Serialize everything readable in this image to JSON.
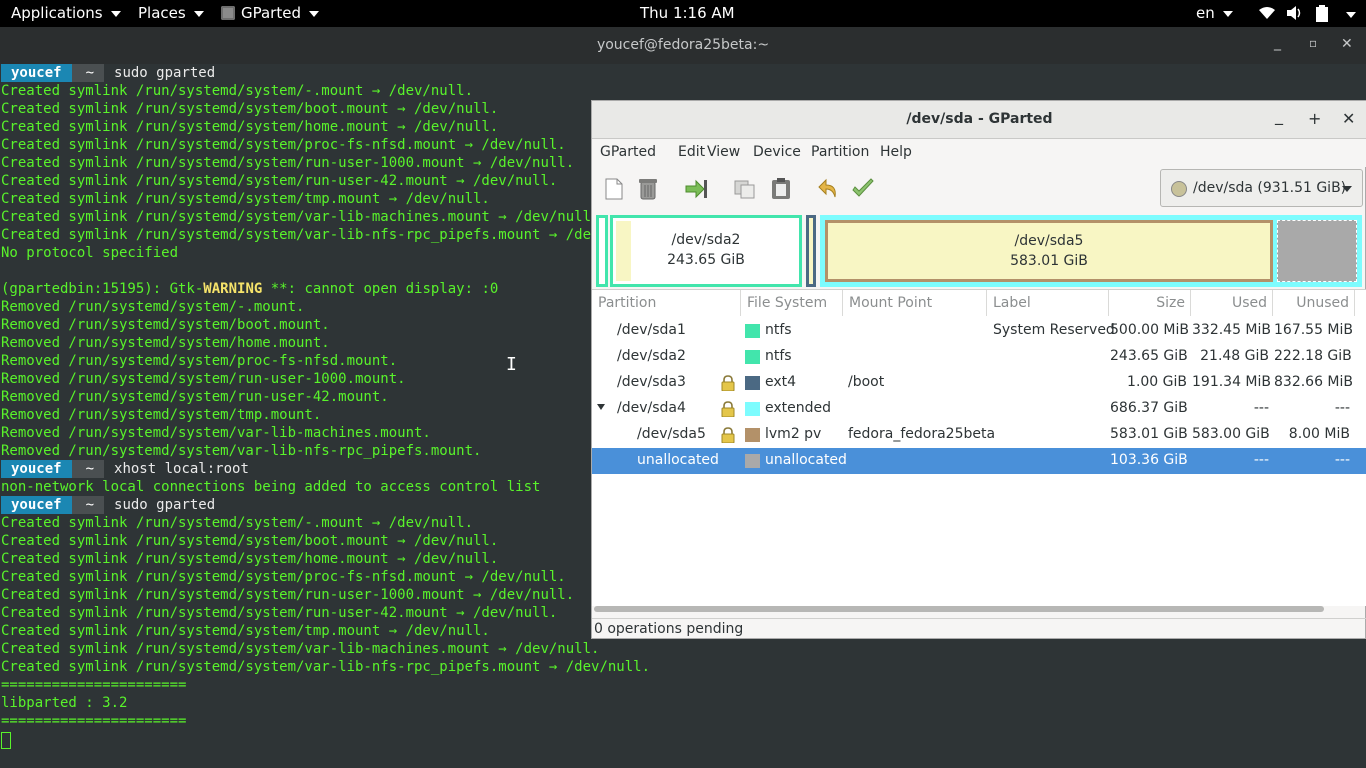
{
  "topbar": {
    "applications": "Applications",
    "places": "Places",
    "app_menu": "GParted",
    "clock": "Thu  1:16 AM",
    "lang": "en"
  },
  "terminal": {
    "title": "youcef@fedora25beta:~",
    "prompt_user": "youcef",
    "prompt_dir": "~",
    "lines": [
      {
        "t": "prompt",
        "cmd": "sudo gparted"
      },
      {
        "t": "text",
        "s": "Created symlink /run/systemd/system/-.mount → /dev/null."
      },
      {
        "t": "text",
        "s": "Created symlink /run/systemd/system/boot.mount → /dev/null."
      },
      {
        "t": "text",
        "s": "Created symlink /run/systemd/system/home.mount → /dev/null."
      },
      {
        "t": "text",
        "s": "Created symlink /run/systemd/system/proc-fs-nfsd.mount → /dev/null."
      },
      {
        "t": "text",
        "s": "Created symlink /run/systemd/system/run-user-1000.mount → /dev/null."
      },
      {
        "t": "text",
        "s": "Created symlink /run/systemd/system/run-user-42.mount → /dev/null."
      },
      {
        "t": "text",
        "s": "Created symlink /run/systemd/system/tmp.mount → /dev/null."
      },
      {
        "t": "text",
        "s": "Created symlink /run/systemd/system/var-lib-machines.mount → /dev/null."
      },
      {
        "t": "text",
        "s": "Created symlink /run/systemd/system/var-lib-nfs-rpc_pipefs.mount → /dev/null."
      },
      {
        "t": "text",
        "s": "No protocol specified"
      },
      {
        "t": "text",
        "s": ""
      },
      {
        "t": "warn",
        "a": "(gpartedbin:15195): Gtk-",
        "b": "WARNING",
        "c": " **: cannot open display: :0"
      },
      {
        "t": "text",
        "s": "Removed /run/systemd/system/-.mount."
      },
      {
        "t": "text",
        "s": "Removed /run/systemd/system/boot.mount."
      },
      {
        "t": "text",
        "s": "Removed /run/systemd/system/home.mount."
      },
      {
        "t": "text",
        "s": "Removed /run/systemd/system/proc-fs-nfsd.mount."
      },
      {
        "t": "text",
        "s": "Removed /run/systemd/system/run-user-1000.mount."
      },
      {
        "t": "text",
        "s": "Removed /run/systemd/system/run-user-42.mount."
      },
      {
        "t": "text",
        "s": "Removed /run/systemd/system/tmp.mount."
      },
      {
        "t": "text",
        "s": "Removed /run/systemd/system/var-lib-machines.mount."
      },
      {
        "t": "text",
        "s": "Removed /run/systemd/system/var-lib-nfs-rpc_pipefs.mount."
      },
      {
        "t": "prompt",
        "cmd": "xhost local:root"
      },
      {
        "t": "text",
        "s": "non-network local connections being added to access control list"
      },
      {
        "t": "prompt",
        "cmd": "sudo gparted"
      },
      {
        "t": "text",
        "s": "Created symlink /run/systemd/system/-.mount → /dev/null."
      },
      {
        "t": "text",
        "s": "Created symlink /run/systemd/system/boot.mount → /dev/null."
      },
      {
        "t": "text",
        "s": "Created symlink /run/systemd/system/home.mount → /dev/null."
      },
      {
        "t": "text",
        "s": "Created symlink /run/systemd/system/proc-fs-nfsd.mount → /dev/null."
      },
      {
        "t": "text",
        "s": "Created symlink /run/systemd/system/run-user-1000.mount → /dev/null."
      },
      {
        "t": "text",
        "s": "Created symlink /run/systemd/system/run-user-42.mount → /dev/null."
      },
      {
        "t": "text",
        "s": "Created symlink /run/systemd/system/tmp.mount → /dev/null."
      },
      {
        "t": "text",
        "s": "Created symlink /run/systemd/system/var-lib-machines.mount → /dev/null."
      },
      {
        "t": "text",
        "s": "Created symlink /run/systemd/system/var-lib-nfs-rpc_pipefs.mount → /dev/null."
      },
      {
        "t": "text",
        "s": "======================"
      },
      {
        "t": "text",
        "s": "libparted : 3.2"
      },
      {
        "t": "text",
        "s": "======================"
      }
    ]
  },
  "gparted": {
    "title": "/dev/sda - GParted",
    "menu": [
      "GParted",
      "Edit",
      "View",
      "Device",
      "Partition",
      "Help"
    ],
    "device_selector": "/dev/sda  (931.51 GiB)",
    "map": {
      "sda2_name": "/dev/sda2",
      "sda2_size": "243.65 GiB",
      "sda5_name": "/dev/sda5",
      "sda5_size": "583.01 GiB"
    },
    "columns": [
      "Partition",
      "File System",
      "Mount Point",
      "Label",
      "Size",
      "Used",
      "Unused"
    ],
    "rows": [
      {
        "partition": "/dev/sda1",
        "fs": "ntfs",
        "fs_color": "#42e5ac",
        "mount": "",
        "label": "System Reserved",
        "size": "500.00 MiB",
        "used": "332.45 MiB",
        "unused": "167.55 MiB",
        "lock": false,
        "indent": false,
        "expander": false
      },
      {
        "partition": "/dev/sda2",
        "fs": "ntfs",
        "fs_color": "#42e5ac",
        "mount": "",
        "label": "",
        "size": "243.65 GiB",
        "used": "21.48 GiB",
        "unused": "222.18 GiB",
        "lock": false,
        "indent": false,
        "expander": false
      },
      {
        "partition": "/dev/sda3",
        "fs": "ext4",
        "fs_color": "#4b6983",
        "mount": "/boot",
        "label": "",
        "size": "1.00 GiB",
        "used": "191.34 MiB",
        "unused": "832.66 MiB",
        "lock": true,
        "indent": false,
        "expander": false
      },
      {
        "partition": "/dev/sda4",
        "fs": "extended",
        "fs_color": "#7dfcfe",
        "mount": "",
        "label": "",
        "size": "686.37 GiB",
        "used": "---",
        "unused": "---",
        "lock": true,
        "indent": false,
        "expander": true
      },
      {
        "partition": "/dev/sda5",
        "fs": "lvm2 pv",
        "fs_color": "#b39169",
        "mount": "fedora_fedora25beta",
        "label": "",
        "size": "583.01 GiB",
        "used": "583.00 GiB",
        "unused": "8.00 MiB",
        "lock": true,
        "indent": true,
        "expander": false
      },
      {
        "partition": "unallocated",
        "fs": "unallocated",
        "fs_color": "#a9a9a9",
        "mount": "",
        "label": "",
        "size": "103.36 GiB",
        "used": "---",
        "unused": "---",
        "lock": false,
        "indent": true,
        "expander": false,
        "selected": true
      }
    ],
    "status": "0 operations pending"
  }
}
